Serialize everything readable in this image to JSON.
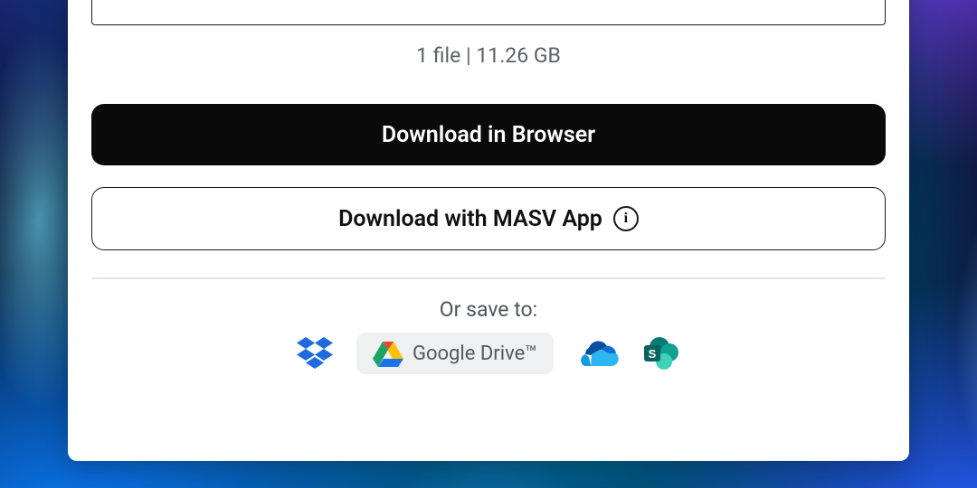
{
  "meta": {
    "summary": "1 file | 11.26 GB"
  },
  "buttons": {
    "primary_label": "Download in Browser",
    "secondary_label": "Download with MASV App"
  },
  "save": {
    "prompt": "Or save to:",
    "google_drive_label": "Google Drive™"
  },
  "info_glyph": "i"
}
